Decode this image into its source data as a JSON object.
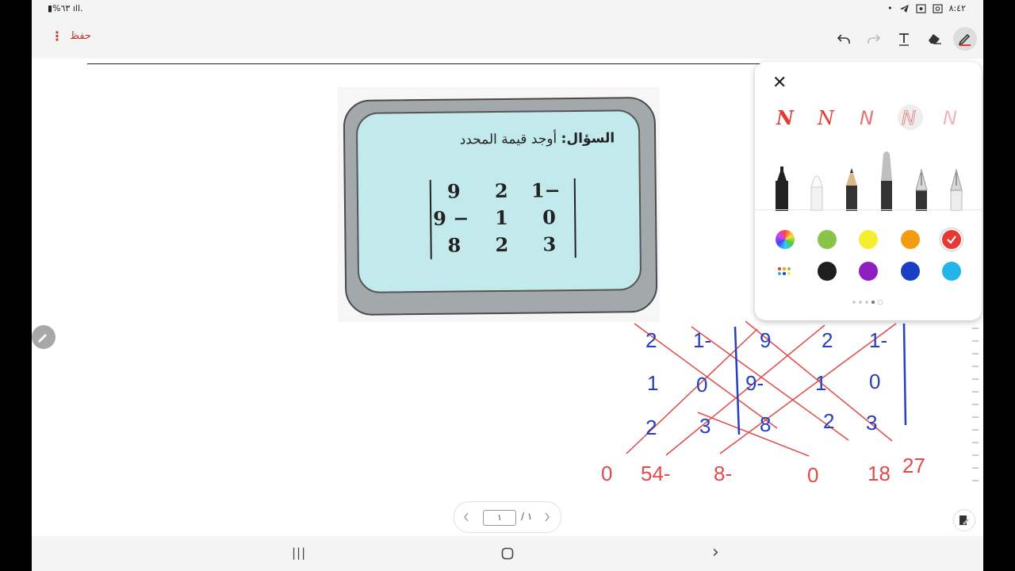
{
  "status": {
    "time": "٨:٤٢",
    "battery": "%٦٣",
    "signal": "ıll."
  },
  "toolbar": {
    "save_label": "حفظ",
    "menu_glyph": "⋮",
    "undo_icon": "undo-icon",
    "redo_icon": "redo-icon",
    "text_icon": "text-tool-icon",
    "eraser_icon": "eraser-icon",
    "pen_icon": "pen-icon"
  },
  "card": {
    "question_label": "السؤال:",
    "question_text": " أوجد قيمة المحدد",
    "matrix": [
      [
        "9",
        "2",
        "1−"
      ],
      [
        "9 −",
        "1",
        "0"
      ],
      [
        "8",
        "2",
        "3"
      ]
    ]
  },
  "handwriting": {
    "left_matrix": [
      [
        "2",
        "1-"
      ],
      [
        "1",
        "0"
      ],
      [
        "2",
        "3"
      ]
    ],
    "right_matrix": [
      [
        "9",
        "2",
        "1-"
      ],
      [
        "9-",
        "1",
        "0"
      ],
      [
        "8",
        "2",
        "3"
      ]
    ],
    "products": [
      "0",
      "54-",
      "8-",
      "0",
      "18",
      "27"
    ],
    "ink_blue": "#2540b8",
    "ink_red": "#e04a4a"
  },
  "pen_panel": {
    "close_glyph": "✕",
    "stroke_glyph": "N",
    "stroke_styles": [
      "bold",
      "medium",
      "thin",
      "outline",
      "light"
    ],
    "pen_types": [
      "marker",
      "brush",
      "pencil",
      "fine-pencil",
      "fountain-pen",
      "calligraphy-pen"
    ],
    "colors_row1": [
      "spectrum",
      "#8bc34a",
      "#f5ee30",
      "#f39c12",
      "#e53935"
    ],
    "colors_row2": [
      "palette",
      "#1e1e1e",
      "#8e1fc0",
      "#1a3fc4",
      "#24b4ea"
    ],
    "selected_color": "#e53935"
  },
  "pager": {
    "current": "١",
    "total": "/ ١"
  },
  "navbar": {
    "recents_glyph": "|||",
    "back_glyph": "›"
  }
}
